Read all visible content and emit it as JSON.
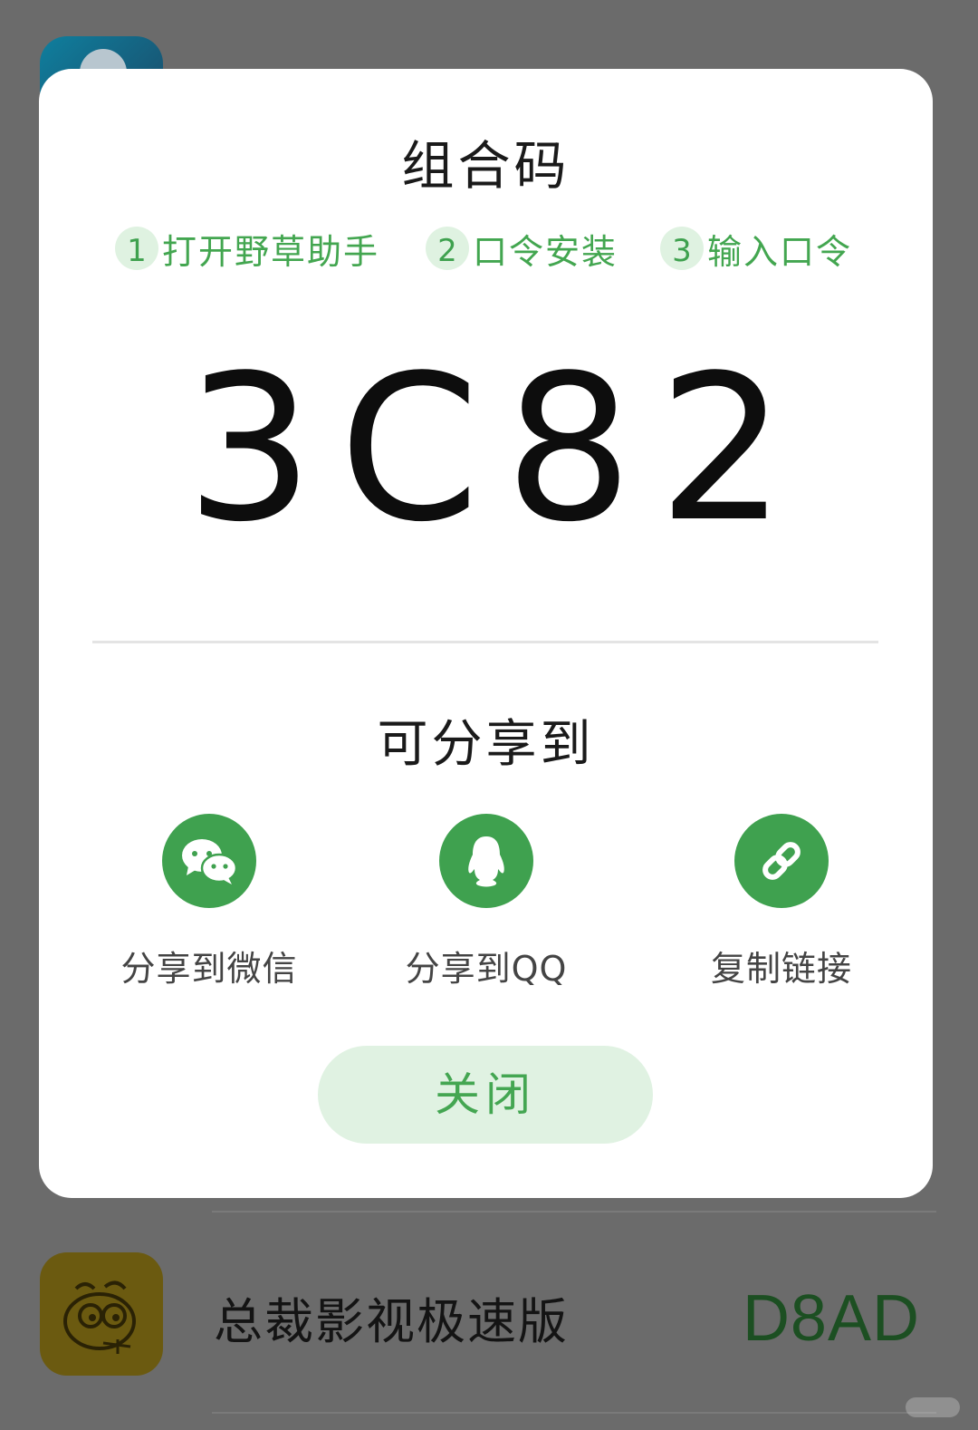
{
  "dialog": {
    "title": "组合码",
    "steps": [
      {
        "num": "1",
        "label": "打开野草助手"
      },
      {
        "num": "2",
        "label": "口令安装"
      },
      {
        "num": "3",
        "label": "输入口令"
      }
    ],
    "code": "3C82",
    "share_title": "可分享到",
    "share_options": [
      {
        "label": "分享到微信",
        "icon": "wechat-icon"
      },
      {
        "label": "分享到QQ",
        "icon": "qq-penguin-icon"
      },
      {
        "label": "复制链接",
        "icon": "link-icon"
      }
    ],
    "close_label": "关闭"
  },
  "background": {
    "app_row": {
      "name": "总裁影视极速版",
      "code": "D8AD"
    }
  },
  "colors": {
    "accent_green": "#3fa14f",
    "light_green": "#e0f2e2",
    "overlay_gray": "#6b6b6b"
  }
}
